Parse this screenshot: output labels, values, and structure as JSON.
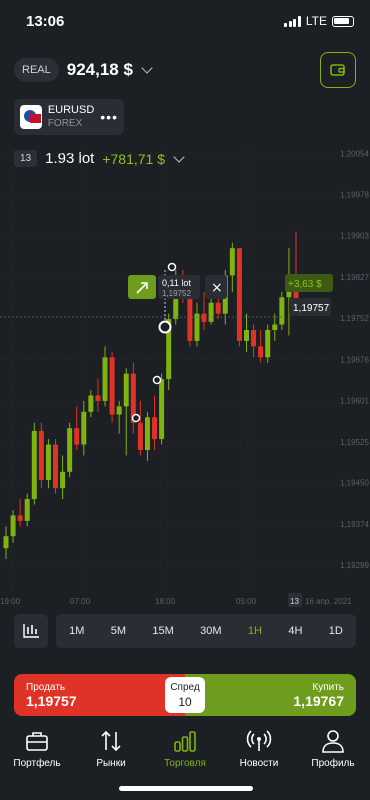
{
  "status": {
    "time": "13:06",
    "network": "LTE"
  },
  "account": {
    "type": "REAL",
    "balance": "924,18 $"
  },
  "asset": {
    "symbol": "EURUSD",
    "category": "FOREX"
  },
  "position": {
    "count": "13",
    "lot": "1.93 lot",
    "profit": "+781,71 $"
  },
  "order_marker": {
    "lot": "0,11 lot",
    "price": "1,19752"
  },
  "current": {
    "profit": "+3,63 $",
    "price": "1,19757"
  },
  "chart_data": {
    "type": "candlestick",
    "y_ticks": [
      "1,20054",
      "1,19978",
      "1,19903",
      "1,19827",
      "1,19752",
      "1,19676",
      "1,19601",
      "1,19525",
      "1,19450",
      "1,19374",
      "1,19299"
    ],
    "x_ticks": [
      "19:00",
      "07:00",
      "18:00",
      "05:00",
      "13",
      "16 апр. 2021"
    ],
    "candles": [
      {
        "o": 1.1933,
        "h": 1.1937,
        "l": 1.1931,
        "c": 1.19352
      },
      {
        "o": 1.19352,
        "h": 1.194,
        "l": 1.1934,
        "c": 1.1939
      },
      {
        "o": 1.1939,
        "h": 1.1942,
        "l": 1.1937,
        "c": 1.1938
      },
      {
        "o": 1.1938,
        "h": 1.1943,
        "l": 1.1937,
        "c": 1.1942
      },
      {
        "o": 1.1942,
        "h": 1.1956,
        "l": 1.1941,
        "c": 1.19545
      },
      {
        "o": 1.19545,
        "h": 1.1956,
        "l": 1.1944,
        "c": 1.19455
      },
      {
        "o": 1.19455,
        "h": 1.1953,
        "l": 1.1944,
        "c": 1.1952
      },
      {
        "o": 1.1952,
        "h": 1.1953,
        "l": 1.1943,
        "c": 1.1944
      },
      {
        "o": 1.1944,
        "h": 1.195,
        "l": 1.1942,
        "c": 1.1947
      },
      {
        "o": 1.1947,
        "h": 1.1956,
        "l": 1.1946,
        "c": 1.1955
      },
      {
        "o": 1.1955,
        "h": 1.1959,
        "l": 1.1951,
        "c": 1.1952
      },
      {
        "o": 1.1952,
        "h": 1.196,
        "l": 1.195,
        "c": 1.1958
      },
      {
        "o": 1.1958,
        "h": 1.1962,
        "l": 1.1957,
        "c": 1.1961
      },
      {
        "o": 1.1961,
        "h": 1.1964,
        "l": 1.1958,
        "c": 1.196
      },
      {
        "o": 1.196,
        "h": 1.197,
        "l": 1.1959,
        "c": 1.1968
      },
      {
        "o": 1.1968,
        "h": 1.1969,
        "l": 1.1956,
        "c": 1.19575
      },
      {
        "o": 1.19575,
        "h": 1.196,
        "l": 1.1954,
        "c": 1.1959
      },
      {
        "o": 1.1959,
        "h": 1.1966,
        "l": 1.195,
        "c": 1.1965
      },
      {
        "o": 1.1965,
        "h": 1.1967,
        "l": 1.1954,
        "c": 1.1956
      },
      {
        "o": 1.1956,
        "h": 1.196,
        "l": 1.195,
        "c": 1.1951
      },
      {
        "o": 1.1951,
        "h": 1.1958,
        "l": 1.1949,
        "c": 1.1957
      },
      {
        "o": 1.1957,
        "h": 1.1961,
        "l": 1.1951,
        "c": 1.1953
      },
      {
        "o": 1.1953,
        "h": 1.1965,
        "l": 1.1952,
        "c": 1.1964
      },
      {
        "o": 1.1964,
        "h": 1.1976,
        "l": 1.1962,
        "c": 1.1975
      },
      {
        "o": 1.1975,
        "h": 1.1984,
        "l": 1.1974,
        "c": 1.1983
      },
      {
        "o": 1.1983,
        "h": 1.1984,
        "l": 1.1978,
        "c": 1.1979
      },
      {
        "o": 1.1979,
        "h": 1.198,
        "l": 1.197,
        "c": 1.1971
      },
      {
        "o": 1.1971,
        "h": 1.1978,
        "l": 1.197,
        "c": 1.1976
      },
      {
        "o": 1.1976,
        "h": 1.198,
        "l": 1.1973,
        "c": 1.19745
      },
      {
        "o": 1.19745,
        "h": 1.1979,
        "l": 1.1974,
        "c": 1.1978
      },
      {
        "o": 1.1978,
        "h": 1.198,
        "l": 1.1975,
        "c": 1.1976
      },
      {
        "o": 1.1976,
        "h": 1.1984,
        "l": 1.1974,
        "c": 1.1983
      },
      {
        "o": 1.1983,
        "h": 1.1989,
        "l": 1.198,
        "c": 1.1988
      },
      {
        "o": 1.1988,
        "h": 1.1988,
        "l": 1.197,
        "c": 1.1971
      },
      {
        "o": 1.1971,
        "h": 1.1976,
        "l": 1.1969,
        "c": 1.1973
      },
      {
        "o": 1.1973,
        "h": 1.1974,
        "l": 1.1968,
        "c": 1.197
      },
      {
        "o": 1.197,
        "h": 1.1973,
        "l": 1.1967,
        "c": 1.1968
      },
      {
        "o": 1.1968,
        "h": 1.1974,
        "l": 1.1967,
        "c": 1.1973
      },
      {
        "o": 1.1973,
        "h": 1.1976,
        "l": 1.1971,
        "c": 1.1974
      },
      {
        "o": 1.1974,
        "h": 1.198,
        "l": 1.1973,
        "c": 1.1979
      },
      {
        "o": 1.1979,
        "h": 1.1988,
        "l": 1.1972,
        "c": 1.1981
      },
      {
        "o": 1.1981,
        "h": 1.1991,
        "l": 1.1976,
        "c": 1.1978
      }
    ],
    "y_range": [
      1.1929,
      1.2006
    ],
    "current_price": 1.19757,
    "bull_color": "#7fb30f",
    "bear_color": "#e03327"
  },
  "timeframes": [
    "1M",
    "5M",
    "15M",
    "30M",
    "1H",
    "4H",
    "1D"
  ],
  "active_timeframe": "1H",
  "trade": {
    "sell_label": "Продать",
    "sell_price": "1,19757",
    "spread_label": "Спред",
    "spread_value": "10",
    "buy_label": "Купить",
    "buy_price": "1,19767"
  },
  "nav": [
    {
      "label": "Портфель",
      "icon": "briefcase-icon"
    },
    {
      "label": "Рынки",
      "icon": "arrows-icon"
    },
    {
      "label": "Торговля",
      "icon": "bars-icon"
    },
    {
      "label": "Новости",
      "icon": "broadcast-icon"
    },
    {
      "label": "Профиль",
      "icon": "user-icon"
    }
  ],
  "active_nav": "Торговля"
}
